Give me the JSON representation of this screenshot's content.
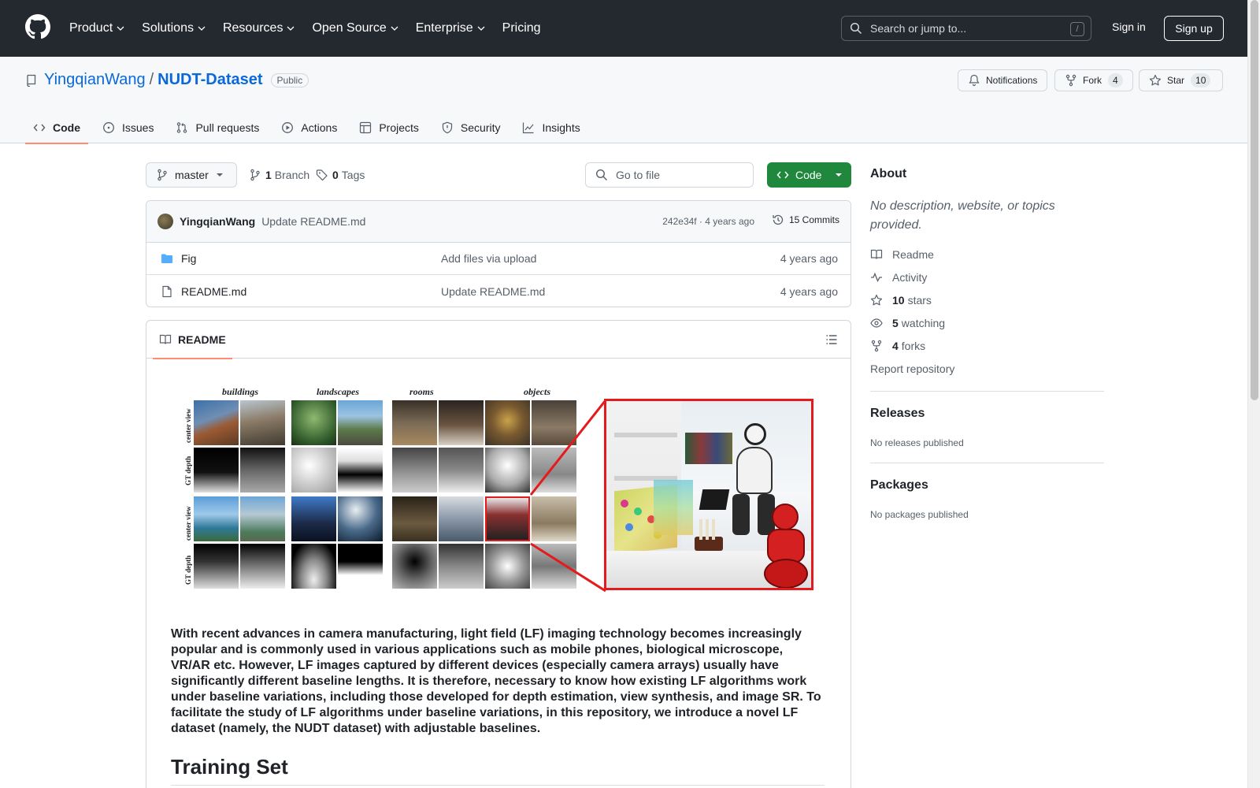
{
  "header": {
    "nav": [
      "Product",
      "Solutions",
      "Resources",
      "Open Source",
      "Enterprise",
      "Pricing"
    ],
    "search_placeholder": "Search or jump to...",
    "search_shortcut": "/",
    "sign_in": "Sign in",
    "sign_up": "Sign up"
  },
  "repo": {
    "owner": "YingqianWang",
    "separator": "/",
    "name": "NUDT-Dataset",
    "visibility": "Public",
    "notifications": "Notifications",
    "fork_label": "Fork",
    "fork_count": "4",
    "star_label": "Star",
    "star_count": "10"
  },
  "tabs": [
    {
      "label": "Code",
      "icon": "code-icon"
    },
    {
      "label": "Issues",
      "icon": "issue-icon"
    },
    {
      "label": "Pull requests",
      "icon": "pull-request-icon"
    },
    {
      "label": "Actions",
      "icon": "play-icon"
    },
    {
      "label": "Projects",
      "icon": "table-icon"
    },
    {
      "label": "Security",
      "icon": "shield-icon"
    },
    {
      "label": "Insights",
      "icon": "graph-icon"
    }
  ],
  "toolbar": {
    "branch": "master",
    "branch_count": "1",
    "branch_label": "Branch",
    "tag_count": "0",
    "tag_label": "Tags",
    "goto_placeholder": "Go to file",
    "code_button": "Code"
  },
  "commit": {
    "author": "YingqianWang",
    "message": "Update README.md",
    "meta": "242e34f · 4 years ago",
    "commits": "15 Commits"
  },
  "files": [
    {
      "name": "Fig",
      "type": "folder",
      "message": "Add files via upload",
      "time": "4 years ago"
    },
    {
      "name": "README.md",
      "type": "file",
      "message": "Update README.md",
      "time": "4 years ago"
    }
  ],
  "readme": {
    "tab": "README",
    "figure": {
      "categories": [
        "buildings",
        "landscapes",
        "rooms",
        "objects"
      ],
      "row_labels": [
        "center view",
        "GT depth",
        "center view",
        "GT depth"
      ]
    },
    "paragraph": "With recent advances in camera manufacturing, light field (LF) imaging technology becomes increasingly popular and is commonly used in various applications such as mobile phones, biological microscope, VR/AR etc. However, LF images captured by different devices (especially camera arrays) usually have significantly different baseline lengths. It is therefore, necessary to know how existing LF algorithms work under baseline variations, including those developed for depth estimation, view synthesis, and image SR. To facilitate the study of LF algorithms under baseline variations, in this repository, we introduce a novel LF dataset (namely, the NUDT dataset) with adjustable baselines.",
    "heading": "Training Set"
  },
  "sidebar": {
    "about": "About",
    "description": "No description, website, or topics provided.",
    "readme": "Readme",
    "activity": "Activity",
    "stars_count": "10",
    "stars_label": "stars",
    "watching_count": "5",
    "watching_label": "watching",
    "forks_count": "4",
    "forks_label": "forks",
    "report": "Report repository",
    "releases": "Releases",
    "releases_empty": "No releases published",
    "packages": "Packages",
    "packages_empty": "No packages published"
  },
  "colors": {
    "header_bg": "#24292f",
    "link": "#0969da",
    "primary_button": "#1f883d",
    "tab_underline": "#fd8c73",
    "figure_highlight": "#e41a1c"
  }
}
